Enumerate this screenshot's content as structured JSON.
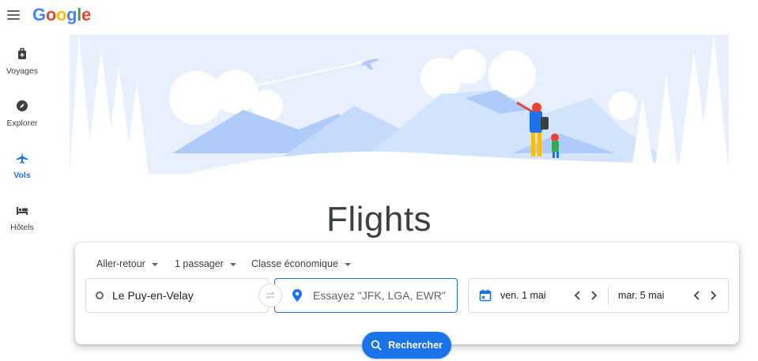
{
  "header": {
    "logo_letters": [
      "G",
      "o",
      "o",
      "g",
      "l",
      "e"
    ],
    "logo_colors": [
      "#4285f4",
      "#ea4335",
      "#fbbc05",
      "#4285f4",
      "#34a853",
      "#ea4335"
    ]
  },
  "nav": {
    "items": [
      {
        "label": "Voyages",
        "icon": "luggage-icon"
      },
      {
        "label": "Explorer",
        "icon": "compass-icon"
      },
      {
        "label": "Vols",
        "icon": "airplane-icon",
        "active": true
      },
      {
        "label": "Hôtels",
        "icon": "bed-icon"
      }
    ]
  },
  "hero": {
    "title": "Flights"
  },
  "search": {
    "trip_type": "Aller-retour",
    "passengers": "1 passager",
    "cabin_class": "Classe économique",
    "origin": "Le Puy-en-Velay",
    "destination_placeholder": "Essayez \"JFK, LGA, EWR\"",
    "departure": "ven. 1 mai",
    "return": "mar. 5 mai",
    "search_label": "Rechercher"
  },
  "colors": {
    "accent": "#1a73e8",
    "hero_sky": "#e8f0fe",
    "hero_mountain": "#aecbfa"
  }
}
